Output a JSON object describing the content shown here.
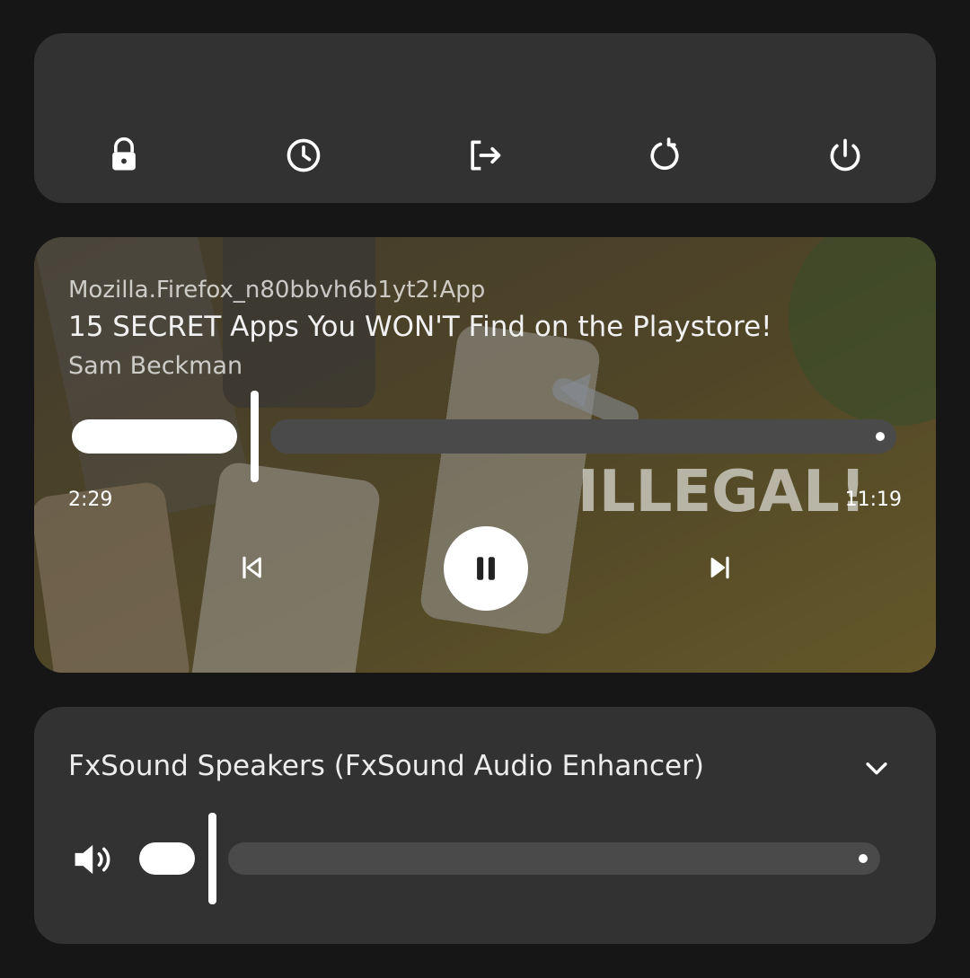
{
  "power_menu": {
    "buttons": [
      {
        "icon": "lock-icon"
      },
      {
        "icon": "clock-icon"
      },
      {
        "icon": "logout-icon"
      },
      {
        "icon": "restart-icon"
      },
      {
        "icon": "power-icon"
      }
    ]
  },
  "media": {
    "app": "Mozilla.Firefox_n80bbvh6b1yt2!App",
    "title": "15 SECRET Apps You WON'T Find on the Playstore!",
    "artist": "Sam Beckman",
    "current_time": "2:29",
    "total_time": "11:19",
    "artwork_text": "ILLEGAL!",
    "progress_fraction": 0.22,
    "controls": {
      "previous": "skip-previous-icon",
      "play_pause": "pause-icon",
      "next": "skip-next-icon"
    }
  },
  "audio": {
    "device_name": "FxSound Speakers (FxSound Audio Enhancer)",
    "volume_fraction": 0.09,
    "icons": {
      "volume": "volume-icon",
      "expand": "chevron-down-icon"
    }
  },
  "colors": {
    "background": "#161616",
    "card": "#323232",
    "track": "#4a4a4a",
    "accent": "#ffffff"
  }
}
